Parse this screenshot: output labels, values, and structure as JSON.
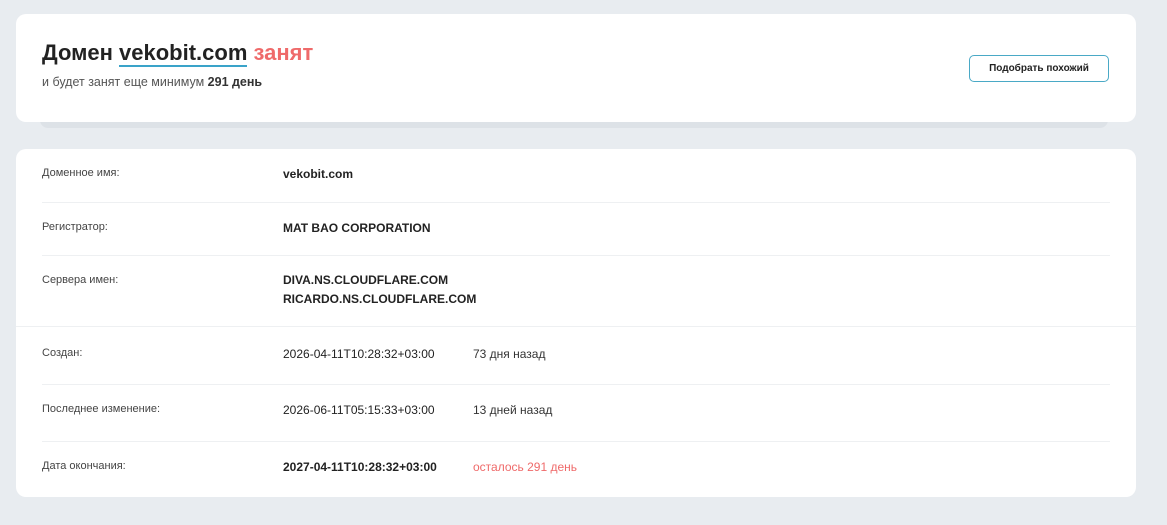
{
  "header": {
    "title_prefix": "Домен",
    "domain": "vekobit.com",
    "status": "занят",
    "subtitle_prefix": "и будет занят еще минимум",
    "subtitle_days": "291 день",
    "similar_button": "Подобрать похожий"
  },
  "details": {
    "domain_name": {
      "label": "Доменное имя:",
      "value": "vekobit.com"
    },
    "registrar": {
      "label": "Регистратор:",
      "value": "MAT BAO CORPORATION"
    },
    "nameservers": {
      "label": "Сервера имен:",
      "values": [
        "DIVA.NS.CLOUDFLARE.COM",
        "RICARDO.NS.CLOUDFLARE.COM"
      ]
    },
    "created": {
      "label": "Создан:",
      "value": "2026-04-11T10:28:32+03:00",
      "ago": "73 дня назад"
    },
    "updated": {
      "label": "Последнее изменение:",
      "value": "2026-06-11T05:15:33+03:00",
      "ago": "13 дней назад"
    },
    "expires": {
      "label": "Дата окончания:",
      "value": "2027-04-11T10:28:32+03:00",
      "remaining": "осталось 291 день"
    }
  },
  "colors": {
    "accent": "#3aa3c9",
    "busy_red": "#ef6a6a",
    "background": "#e8ecf0"
  }
}
